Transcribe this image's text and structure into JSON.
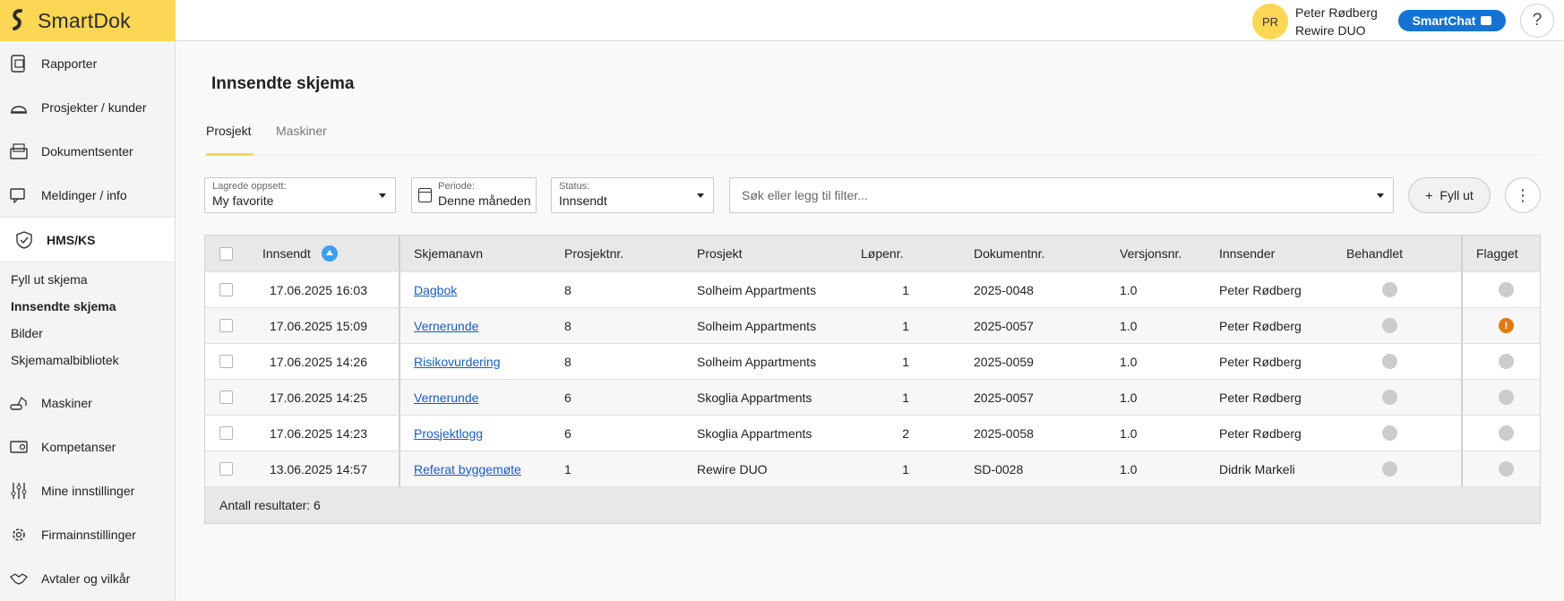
{
  "app": {
    "logo_text": "SmartDok"
  },
  "user": {
    "initials": "PR",
    "name": "Peter Rødberg",
    "company": "Rewire DUO"
  },
  "header": {
    "smartchat_label": "SmartChat",
    "help_label": "?"
  },
  "sidebar": {
    "items_top": [
      {
        "label": "Rapporter",
        "icon": "report-icon"
      },
      {
        "label": "Prosjekter / kunder",
        "icon": "helmet-icon"
      },
      {
        "label": "Dokumentsenter",
        "icon": "document-center-icon"
      },
      {
        "label": "Meldinger / info",
        "icon": "message-icon"
      }
    ],
    "active_section": {
      "label": "HMS/KS",
      "icon": "shield-check-icon"
    },
    "sub_items": [
      "Fyll ut skjema",
      "Innsendte skjema",
      "Bilder",
      "Skjemamalbibliotek"
    ],
    "current_sub_item": "Innsendte skjema",
    "items_bottom": [
      {
        "label": "Maskiner",
        "icon": "excavator-icon"
      },
      {
        "label": "Kompetanser",
        "icon": "certificate-icon"
      },
      {
        "label": "Mine innstillinger",
        "icon": "sliders-icon"
      },
      {
        "label": "Firmainnstillinger",
        "icon": "gear-icon"
      },
      {
        "label": "Avtaler og vilkår",
        "icon": "handshake-icon"
      }
    ]
  },
  "page": {
    "title": "Innsendte skjema"
  },
  "tabs": [
    "Prosjekt",
    "Maskiner"
  ],
  "active_tab": "Prosjekt",
  "filters": {
    "saved_layout": {
      "label": "Lagrede oppsett:",
      "value": "My favorite"
    },
    "period": {
      "label": "Periode:",
      "value": "Denne måneden"
    },
    "status": {
      "label": "Status:",
      "value": "Innsendt"
    },
    "search": {
      "placeholder": "Søk eller legg til filter..."
    },
    "fill_button": "Fyll ut",
    "more_button": "⋮"
  },
  "table": {
    "columns": [
      "Innsendt",
      "Skjemanavn",
      "Prosjektnr.",
      "Prosjekt",
      "Løpenr.",
      "Dokumentnr.",
      "Versjonsnr.",
      "Innsender",
      "Behandlet",
      "Flagget"
    ],
    "sort_column": "Innsendt",
    "sort_direction": "ascending",
    "rows": [
      {
        "submitted": "17.06.2025 16:03",
        "form": "Dagbok",
        "project_no": "8",
        "project": "Solheim Appartments",
        "seq": "1",
        "doc_no": "2025-0048",
        "version": "1.0",
        "submitter": "Peter Rødberg",
        "processed": false,
        "flagged": false
      },
      {
        "submitted": "17.06.2025 15:09",
        "form": "Vernerunde",
        "project_no": "8",
        "project": "Solheim Appartments",
        "seq": "1",
        "doc_no": "2025-0057",
        "version": "1.0",
        "submitter": "Peter Rødberg",
        "processed": false,
        "flagged": true,
        "flag_text": "!"
      },
      {
        "submitted": "17.06.2025 14:26",
        "form": "Risikovurdering",
        "project_no": "8",
        "project": "Solheim Appartments",
        "seq": "1",
        "doc_no": "2025-0059",
        "version": "1.0",
        "submitter": "Peter Rødberg",
        "processed": false,
        "flagged": false
      },
      {
        "submitted": "17.06.2025 14:25",
        "form": "Vernerunde",
        "project_no": "6",
        "project": "Skoglia Appartments",
        "seq": "1",
        "doc_no": "2025-0057",
        "version": "1.0",
        "submitter": "Peter Rødberg",
        "processed": false,
        "flagged": false
      },
      {
        "submitted": "17.06.2025 14:23",
        "form": "Prosjektlogg",
        "project_no": "6",
        "project": "Skoglia Appartments",
        "seq": "2",
        "doc_no": "2025-0058",
        "version": "1.0",
        "submitter": "Peter Rødberg",
        "processed": false,
        "flagged": false
      },
      {
        "submitted": "13.06.2025 14:57",
        "form": "Referat byggemøte",
        "project_no": "1",
        "project": "Rewire DUO",
        "seq": "1",
        "doc_no": "SD-0028",
        "version": "1.0",
        "submitter": "Didrik Markeli",
        "processed": false,
        "flagged": false
      }
    ],
    "footer": "Antall resultater: 6"
  },
  "colors": {
    "brand_yellow": "#fcd755",
    "smartchat_blue": "#1573d4",
    "link_blue": "#1c5cb8",
    "flag_warning": "#e07b0d",
    "status_neutral": "#cccccc",
    "sort_blue": "#3a9ff2"
  }
}
